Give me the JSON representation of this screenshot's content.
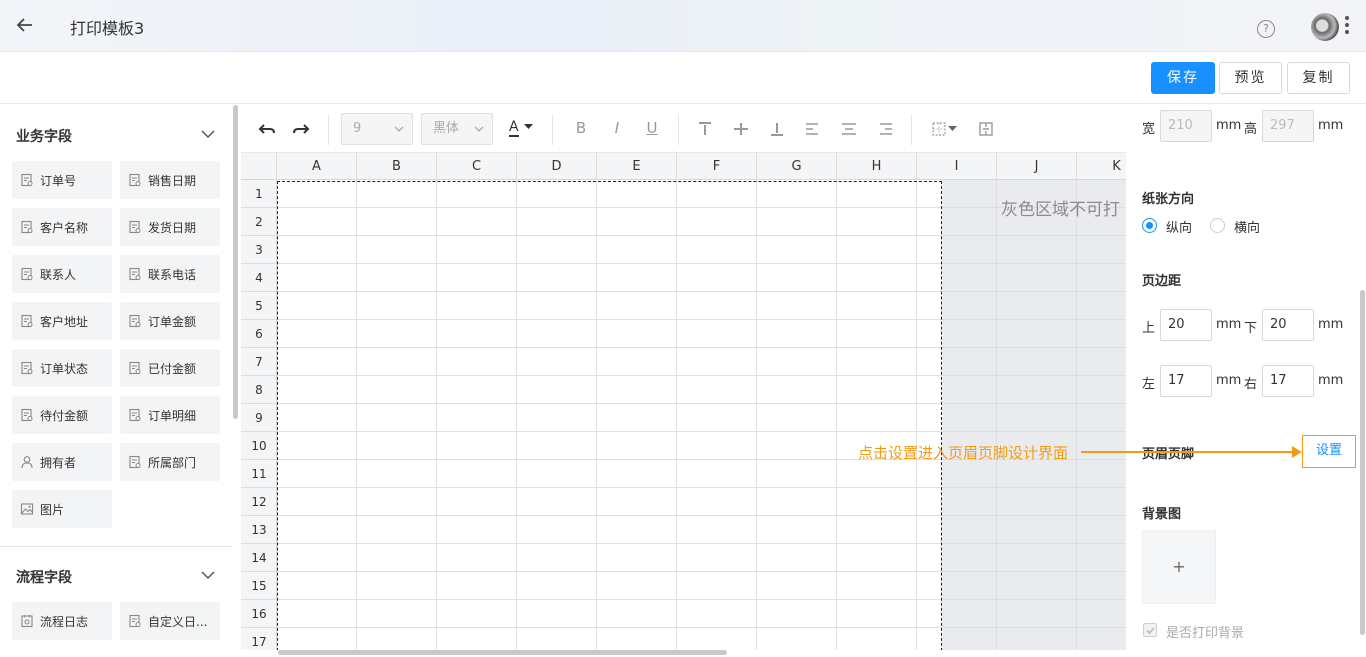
{
  "header": {
    "title": "打印模板3"
  },
  "actions": {
    "save": "保存",
    "preview": "预览",
    "copy": "复制"
  },
  "left_panel": {
    "business_fields": {
      "title": "业务字段",
      "items": [
        "订单号",
        "销售日期",
        "客户名称",
        "发货日期",
        "联系人",
        "联系电话",
        "客户地址",
        "订单金额",
        "订单状态",
        "已付金额",
        "待付金额",
        "订单明细",
        "拥有者",
        "所属部门",
        "图片"
      ]
    },
    "process_fields": {
      "title": "流程字段",
      "items": [
        "流程日志",
        "自定义日..."
      ]
    }
  },
  "toolbar": {
    "font_size": "9",
    "font_family": "黑体",
    "font_color_label": "A",
    "bold": "B",
    "italic": "I",
    "underline": "U"
  },
  "sheet": {
    "columns": [
      "A",
      "B",
      "C",
      "D",
      "E",
      "F",
      "G",
      "H",
      "I",
      "J",
      "K"
    ],
    "rows": [
      "1",
      "2",
      "3",
      "4",
      "5",
      "6",
      "7",
      "8",
      "9",
      "10",
      "11",
      "12",
      "13",
      "14",
      "15",
      "16",
      "17"
    ],
    "gray_note": "灰色区域不可打"
  },
  "right_panel": {
    "width_label": "宽",
    "width_value": "210",
    "height_label": "高",
    "height_value": "297",
    "unit": "mm",
    "orientation_title": "纸张方向",
    "portrait": "纵向",
    "landscape": "横向",
    "margin_title": "页边距",
    "top_label": "上",
    "top_value": "20",
    "bottom_label": "下",
    "bottom_value": "20",
    "left_label": "左",
    "left_value": "17",
    "right_label": "右",
    "right_value": "17",
    "header_footer_title": "页眉页脚",
    "setup_button": "设置",
    "background_title": "背景图",
    "upload_plus": "+",
    "print_background": "是否打印背景"
  },
  "callout": {
    "text": "点击设置进入页眉页脚设计界面"
  },
  "colors": {
    "primary": "#1890ff",
    "callout": "#f39c12"
  },
  "icons": [
    "back-arrow-icon",
    "help-icon",
    "more-icon",
    "chevron-down-icon",
    "field-icon",
    "user-icon",
    "image-icon",
    "log-icon",
    "undo-icon",
    "redo-icon",
    "align-top-icon",
    "align-middle-icon",
    "align-bottom-icon",
    "align-left-icon",
    "align-center-icon",
    "align-right-icon",
    "border-icon",
    "merge-icon"
  ]
}
